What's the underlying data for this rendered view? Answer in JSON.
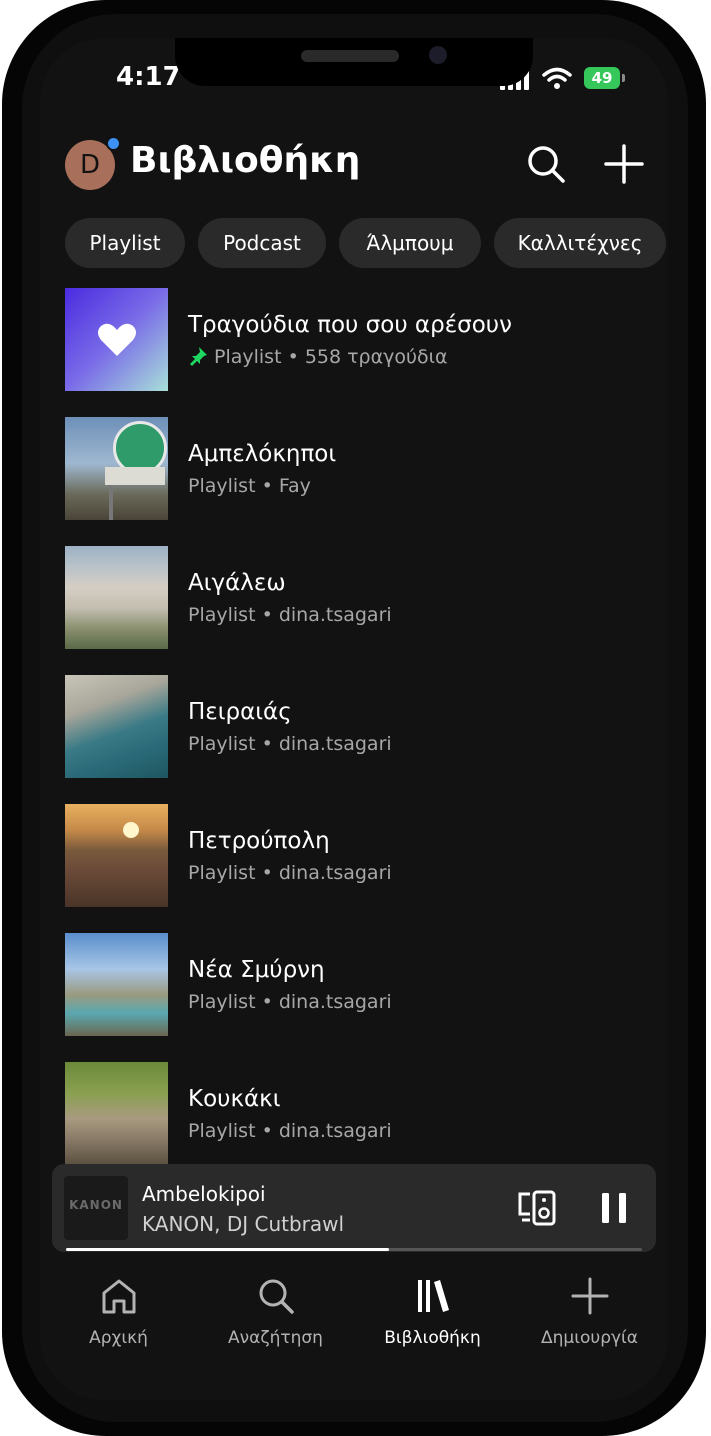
{
  "status_bar": {
    "time": "4:17",
    "battery": "49"
  },
  "header": {
    "avatar_initial": "D",
    "title": "Βιβλιοθήκη"
  },
  "filters": [
    {
      "label": "Playlist"
    },
    {
      "label": "Podcast"
    },
    {
      "label": "Άλμπουμ"
    },
    {
      "label": "Καλλιτέχνες"
    }
  ],
  "library": [
    {
      "title": "Τραγούδια που σου αρέσουν",
      "subtitle": "Playlist • 558 τραγούδια",
      "pinned": true
    },
    {
      "title": "Αμπελόκηποι",
      "subtitle": "Playlist • Fay"
    },
    {
      "title": "Αιγάλεω",
      "subtitle": "Playlist • dina.tsagari"
    },
    {
      "title": "Πειραιάς",
      "subtitle": "Playlist • dina.tsagari"
    },
    {
      "title": "Πετρούπολη",
      "subtitle": "Playlist • dina.tsagari"
    },
    {
      "title": "Νέα Σμύρνη",
      "subtitle": "Playlist • dina.tsagari"
    },
    {
      "title": "Κουκάκι",
      "subtitle": "Playlist • dina.tsagari"
    }
  ],
  "now_playing": {
    "title": "Ambelokipoi",
    "artist": "KANON, DJ Cutbrawl",
    "art_text": "KANON",
    "progress": 0.56
  },
  "bottom_nav": [
    {
      "label": "Αρχική",
      "icon": "home-icon"
    },
    {
      "label": "Αναζήτηση",
      "icon": "search-icon"
    },
    {
      "label": "Βιβλιοθήκη",
      "icon": "library-icon",
      "active": true
    },
    {
      "label": "Δημιουργία",
      "icon": "plus-icon"
    }
  ],
  "colors": {
    "accent": "#1ed760",
    "background": "#121212",
    "chip": "#2a2a2a"
  }
}
